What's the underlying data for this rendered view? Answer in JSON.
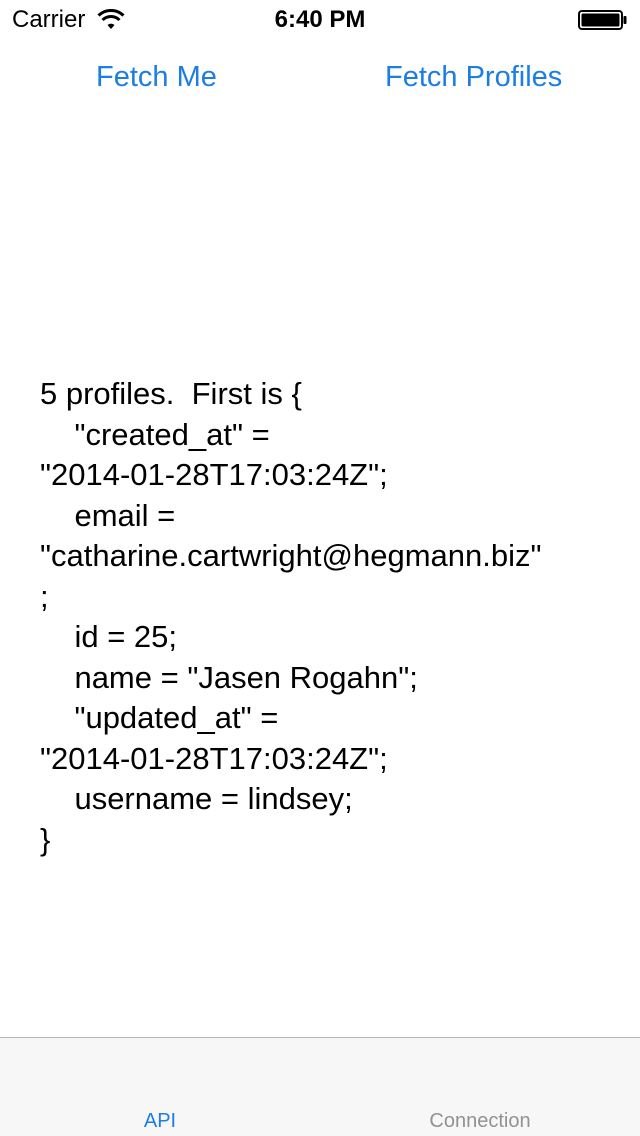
{
  "status_bar": {
    "carrier": "Carrier",
    "time": "6:40 PM",
    "wifi_icon": "wifi-icon",
    "battery_icon": "battery-full-icon"
  },
  "actions": {
    "fetch_me_label": "Fetch Me",
    "fetch_profiles_label": "Fetch Profiles"
  },
  "output": {
    "lines": [
      "5 profiles.  First is {",
      "    \"created_at\" =",
      "\"2014-01-28T17:03:24Z\";",
      "    email =",
      "\"catharine.cartwright@hegmann.biz\"",
      ";",
      "    id = 25;",
      "    name = \"Jasen Rogahn\";",
      "    \"updated_at\" =",
      "\"2014-01-28T17:03:24Z\";",
      "    username = lindsey;",
      "}"
    ]
  },
  "tab_bar": {
    "tabs": [
      {
        "label": "API",
        "selected": true
      },
      {
        "label": "Connection",
        "selected": false
      }
    ]
  },
  "colors": {
    "accent": "#1a7ee6",
    "tab_inactive": "#929292",
    "tab_bar_bg": "#f7f7f8"
  }
}
